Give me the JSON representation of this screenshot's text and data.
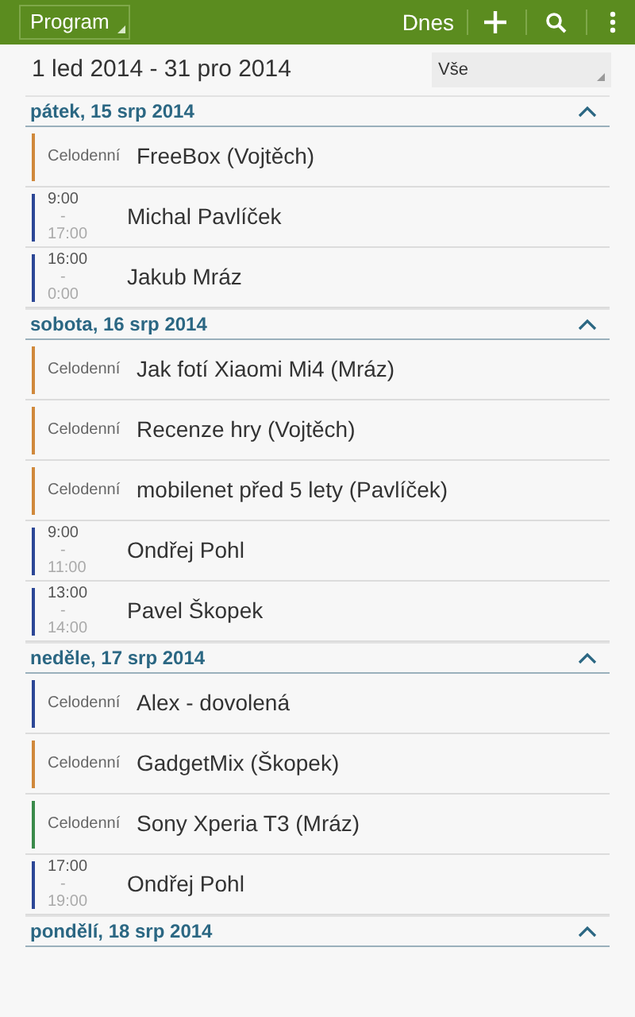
{
  "app_bar": {
    "view": "Program",
    "today": "Dnes"
  },
  "range": {
    "label": "1 led 2014 - 31 pro 2014",
    "filter": "Vše"
  },
  "days": [
    {
      "title": "pátek, 15 srp 2014",
      "expanded": true,
      "events": [
        {
          "kind": "allday",
          "time": "Celodenní",
          "title": "FreeBox (Vojtěch)",
          "color": "#d0893c"
        },
        {
          "kind": "timed",
          "start": "9:00",
          "separator": "-",
          "end": "17:00",
          "title": "Michal Pavlíček",
          "color": "#2c4796"
        },
        {
          "kind": "timed",
          "start": "16:00",
          "separator": "-",
          "end": "0:00",
          "title": "Jakub Mráz",
          "color": "#2c4796"
        }
      ]
    },
    {
      "title": "sobota, 16 srp 2014",
      "expanded": true,
      "events": [
        {
          "kind": "allday",
          "time": "Celodenní",
          "title": "Jak fotí Xiaomi Mi4 (Mráz)",
          "color": "#d0893c"
        },
        {
          "kind": "allday",
          "time": "Celodenní",
          "title": "Recenze hry (Vojtěch)",
          "color": "#d0893c"
        },
        {
          "kind": "allday",
          "time": "Celodenní",
          "title": "mobilenet před 5 lety (Pavlíček)",
          "color": "#d0893c"
        },
        {
          "kind": "timed",
          "start": "9:00",
          "separator": "-",
          "end": "11:00",
          "title": "Ondřej Pohl",
          "color": "#2c4796"
        },
        {
          "kind": "timed",
          "start": "13:00",
          "separator": "-",
          "end": "14:00",
          "title": "Pavel Škopek",
          "color": "#2c4796"
        }
      ]
    },
    {
      "title": "neděle, 17 srp 2014",
      "expanded": true,
      "events": [
        {
          "kind": "allday",
          "time": "Celodenní",
          "title": "Alex - dovolená",
          "color": "#2c4796"
        },
        {
          "kind": "allday",
          "time": "Celodenní",
          "title": "GadgetMix (Škopek)",
          "color": "#d0893c"
        },
        {
          "kind": "allday",
          "time": "Celodenní",
          "title": "Sony Xperia T3 (Mráz)",
          "color": "#3a8a4a"
        },
        {
          "kind": "timed",
          "start": "17:00",
          "separator": "-",
          "end": "19:00",
          "title": "Ondřej Pohl",
          "color": "#2c4796"
        }
      ]
    },
    {
      "title": "pondělí, 18 srp 2014",
      "expanded": true
    }
  ]
}
